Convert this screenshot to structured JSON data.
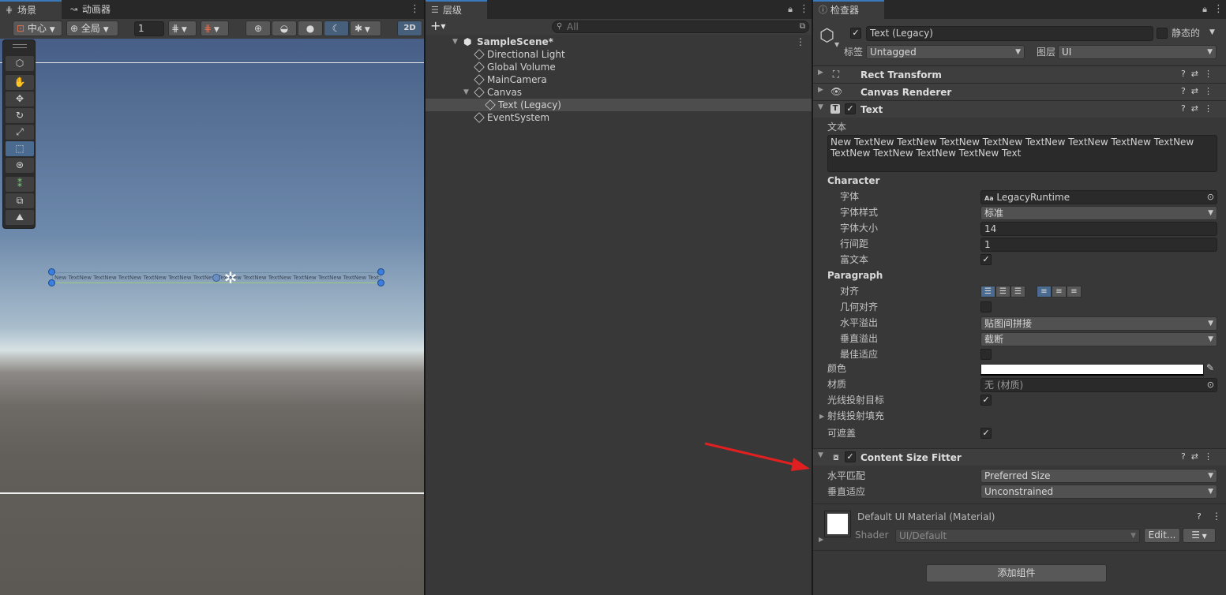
{
  "scene_panel": {
    "tabs": [
      {
        "label": "场景",
        "icon": "grid-icon"
      },
      {
        "label": "动画器",
        "icon": "animator-icon"
      }
    ],
    "toolbar": {
      "pivot_mode": "中心",
      "pivot_rotation": "全局",
      "grid_size": "1",
      "mode_2d": "2D"
    },
    "scene_text_preview": "New TextNew TextNew TextNew TextNew TextNew TextNew TextNew TextNew TextNew TextNew TextNew TextNew Text"
  },
  "hierarchy_panel": {
    "tab_label": "层级",
    "add_label": "+",
    "search_placeholder": "All",
    "scene_name": "SampleScene*",
    "items": [
      {
        "label": "Directional Light",
        "depth": 1
      },
      {
        "label": "Global Volume",
        "depth": 1
      },
      {
        "label": "MainCamera",
        "depth": 1
      },
      {
        "label": "Canvas",
        "depth": 1,
        "expanded": true
      },
      {
        "label": "Text (Legacy)",
        "depth": 2,
        "selected": true
      },
      {
        "label": "EventSystem",
        "depth": 1
      }
    ]
  },
  "inspector_panel": {
    "tab_label": "检查器",
    "object_name": "Text (Legacy)",
    "active": true,
    "static_label": "静态的",
    "tag_label": "标签",
    "tag_value": "Untagged",
    "layer_label": "图层",
    "layer_value": "UI",
    "components": {
      "rect_transform": "Rect Transform",
      "canvas_renderer": "Canvas Renderer",
      "text": "Text",
      "content_size_fitter": "Content Size Fitter"
    },
    "text_component": {
      "text_label": "文本",
      "text_value": "New TextNew TextNew TextNew TextNew TextNew TextNew TextNew TextNew TextNew TextNew TextNew TextNew Text",
      "character_header": "Character",
      "font_label": "字体",
      "font_value": "LegacyRuntime",
      "font_style_label": "字体样式",
      "font_style_value": "标准",
      "font_size_label": "字体大小",
      "font_size_value": "14",
      "line_spacing_label": "行间距",
      "line_spacing_value": "1",
      "rich_text_label": "富文本",
      "paragraph_header": "Paragraph",
      "alignment_label": "对齐",
      "align_by_geometry_label": "几何对齐",
      "horizontal_overflow_label": "水平溢出",
      "horizontal_overflow_value": "贴图间拼接",
      "vertical_overflow_label": "垂直溢出",
      "vertical_overflow_value": "截断",
      "best_fit_label": "最佳适应",
      "color_label": "颜色",
      "material_label": "材质",
      "material_value": "无 (材质)",
      "raycast_target_label": "光线投射目标",
      "raycast_padding_label": "射线投射填充",
      "maskable_label": "可遮盖"
    },
    "content_size_fitter": {
      "horizontal_fit_label": "水平匹配",
      "horizontal_fit_value": "Preferred Size",
      "vertical_fit_label": "垂直适应",
      "vertical_fit_value": "Unconstrained"
    },
    "material_block": {
      "title": "Default UI Material (Material)",
      "shader_label": "Shader",
      "shader_value": "UI/Default",
      "edit_label": "Edit..."
    },
    "add_component_label": "添加组件"
  },
  "colors": {
    "accent": "#3a79bb",
    "annotation_arrow": "#e02020",
    "sky_top": "#4a6a96",
    "ground": "#5e5a55"
  }
}
